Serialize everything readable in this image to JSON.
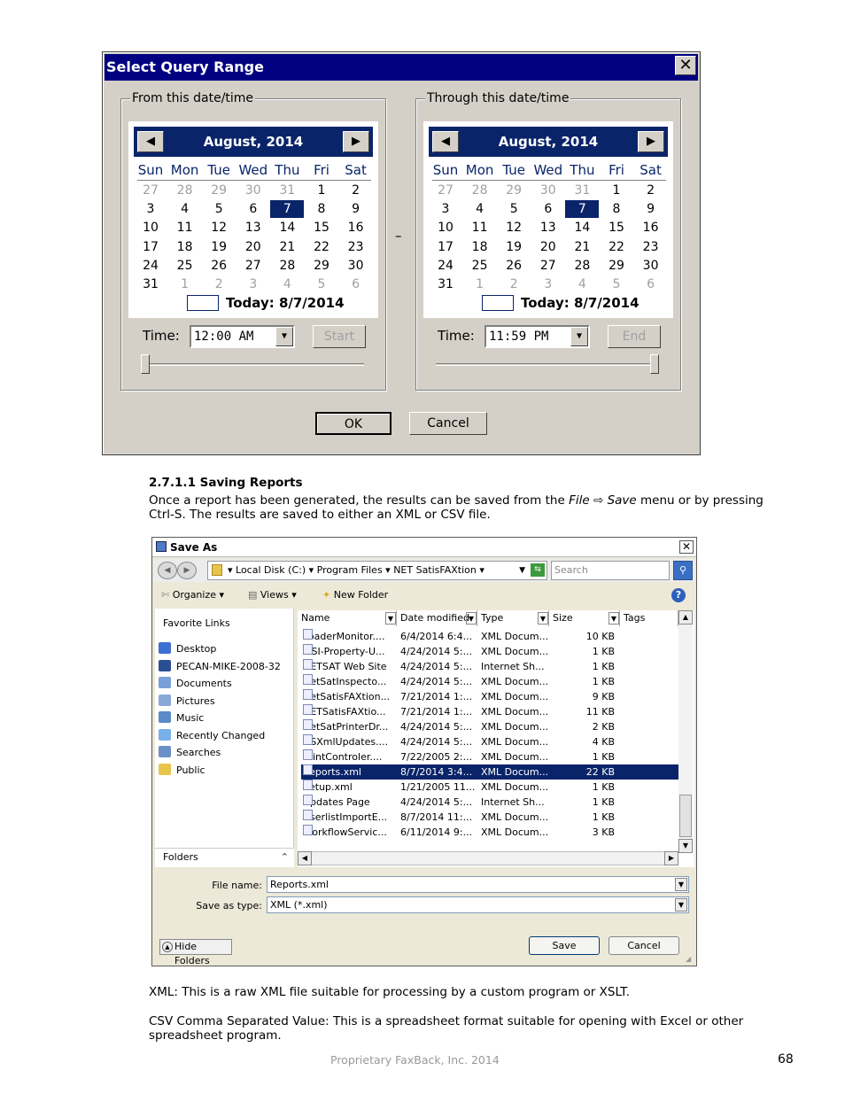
{
  "query_dialog": {
    "title": "Select Query Range",
    "close": "✕",
    "from": {
      "group_label": "From this date/time",
      "month": "August, 2014",
      "time": "12:00 AM",
      "button": "Start"
    },
    "through": {
      "group_label": "Through this date/time",
      "month": "August, 2014",
      "time": "11:59 PM",
      "button": "End"
    },
    "weekdays": [
      "Sun",
      "Mon",
      "Tue",
      "Wed",
      "Thu",
      "Fri",
      "Sat"
    ],
    "weeks": [
      [
        "27",
        "28",
        "29",
        "30",
        "31",
        "1",
        "2"
      ],
      [
        "3",
        "4",
        "5",
        "6",
        "7",
        "8",
        "9"
      ],
      [
        "10",
        "11",
        "12",
        "13",
        "14",
        "15",
        "16"
      ],
      [
        "17",
        "18",
        "19",
        "20",
        "21",
        "22",
        "23"
      ],
      [
        "24",
        "25",
        "26",
        "27",
        "28",
        "29",
        "30"
      ],
      [
        "31",
        "1",
        "2",
        "3",
        "4",
        "5",
        "6"
      ]
    ],
    "selected_day": "7",
    "today": "Today: 8/7/2014",
    "time_label": "Time:",
    "separator": "–",
    "prev_arrow": "◀",
    "next_arrow": "▶",
    "ok": "OK",
    "cancel": "Cancel"
  },
  "doc": {
    "heading": "2.7.1.1 Saving Reports",
    "para1_a": "Once a report has been generated, the results can be saved from the ",
    "para1_file": "File",
    "para1_arrow": " ⇨ ",
    "para1_save": "Save",
    "para1_b": " menu or by pressing",
    "para1_line2": "Ctrl-S. The results are saved to either an XML or CSV file.",
    "xml_note": "XML: This is a raw XML file suitable for processing by a custom program or XSLT.",
    "csv_note_line1": "CSV Comma Separated Value: This is a spreadsheet format suitable for opening with Excel or other",
    "csv_note_line2": "spreadsheet program.",
    "footer": "Proprietary FaxBack, Inc. 2014",
    "page_number": "68"
  },
  "saveas": {
    "title": "Save As",
    "close": "✕",
    "address": "▾ Local Disk (C:) ▾ Program Files ▾ NET SatisFAXtion ▾",
    "search_placeholder": "Search",
    "toolbar": {
      "organize": "Organize ▾",
      "views": "Views ▾",
      "new_folder": "New Folder",
      "help": "?"
    },
    "favorite_links_title": "Favorite Links",
    "favorites": [
      "Desktop",
      "PECAN-MIKE-2008-32",
      "Documents",
      "Pictures",
      "Music",
      "Recently Changed",
      "Searches",
      "Public"
    ],
    "folders_label": "Folders",
    "columns": [
      "Name",
      "Date modified",
      "Type",
      "Size",
      "Tags"
    ],
    "files": [
      {
        "name": "LoaderMonitor....",
        "date": "6/4/2014 6:4...",
        "type": "XML Docum...",
        "size": "10 KB"
      },
      {
        "name": "MSI-Property-U...",
        "date": "4/24/2014 5:...",
        "type": "XML Docum...",
        "size": "1 KB"
      },
      {
        "name": "NETSAT Web Site",
        "date": "4/24/2014 5:...",
        "type": "Internet Sh...",
        "size": "1 KB"
      },
      {
        "name": "NetSatInspecto...",
        "date": "4/24/2014 5:...",
        "type": "XML Docum...",
        "size": "1 KB"
      },
      {
        "name": "NetSatisFAXtion...",
        "date": "7/21/2014 1:...",
        "type": "XML Docum...",
        "size": "9 KB"
      },
      {
        "name": "NETSatisFAXtio...",
        "date": "7/21/2014 1:...",
        "type": "XML Docum...",
        "size": "11 KB"
      },
      {
        "name": "NetSatPrinterDr...",
        "date": "4/24/2014 5:...",
        "type": "XML Docum...",
        "size": "2 KB"
      },
      {
        "name": "NSXmlUpdates....",
        "date": "4/24/2014 5:...",
        "type": "XML Docum...",
        "size": "4 KB"
      },
      {
        "name": "PrintControler....",
        "date": "7/22/2005 2:...",
        "type": "XML Docum...",
        "size": "1 KB"
      },
      {
        "name": "Reports.xml",
        "date": "8/7/2014 3:4...",
        "type": "XML Docum...",
        "size": "22 KB"
      },
      {
        "name": "Setup.xml",
        "date": "1/21/2005 11...",
        "type": "XML Docum...",
        "size": "1 KB"
      },
      {
        "name": "Updates Page",
        "date": "4/24/2014 5:...",
        "type": "Internet Sh...",
        "size": "1 KB"
      },
      {
        "name": "UserlistImportE...",
        "date": "8/7/2014 11:...",
        "type": "XML Docum...",
        "size": "1 KB"
      },
      {
        "name": "WorkflowServic...",
        "date": "6/11/2014 9:...",
        "type": "XML Docum...",
        "size": "3 KB"
      }
    ],
    "selected_file_index": 9,
    "file_name_label": "File name:",
    "file_name_value": "Reports.xml",
    "save_type_label": "Save as type:",
    "save_type_value": "XML (*.xml)",
    "hide_folders": "Hide Folders",
    "save": "Save",
    "cancel": "Cancel"
  }
}
